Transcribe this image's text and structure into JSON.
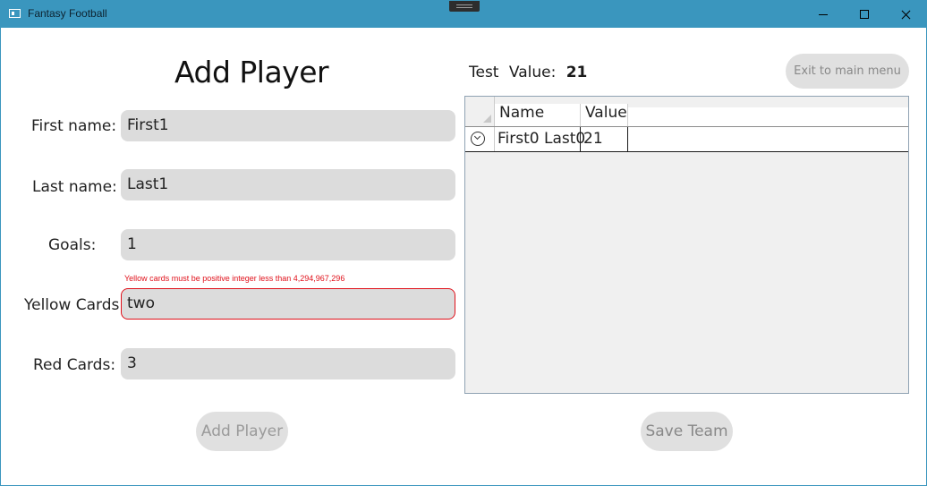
{
  "window": {
    "title": "Fantasy Football"
  },
  "form": {
    "heading": "Add Player",
    "first_name_label": "First name:",
    "first_name_value": "First1",
    "last_name_label": "Last name:",
    "last_name_value": "Last1",
    "goals_label": "Goals:",
    "goals_value": "1",
    "yellow_cards_label": "Yellow Cards:",
    "yellow_cards_value": "two",
    "yellow_cards_error": "Yellow cards must be positive integer less than 4,294,967,296",
    "red_cards_label": "Red Cards:",
    "red_cards_value": "3",
    "add_button": "Add Player"
  },
  "team": {
    "name": "Test",
    "value_label": "Value:",
    "value": "21",
    "exit_button": "Exit to main menu",
    "save_button": "Save Team",
    "columns": [
      "Name",
      "Value"
    ],
    "rows": [
      {
        "name": "First0 Last0",
        "value": "21"
      }
    ]
  },
  "colors": {
    "titlebar": "#3a96be",
    "error": "#e0101a",
    "field_bg": "#dcdcdc"
  },
  "icons": {
    "app": "window-app-icon",
    "row_expand": "chevron-down-circle-icon"
  }
}
